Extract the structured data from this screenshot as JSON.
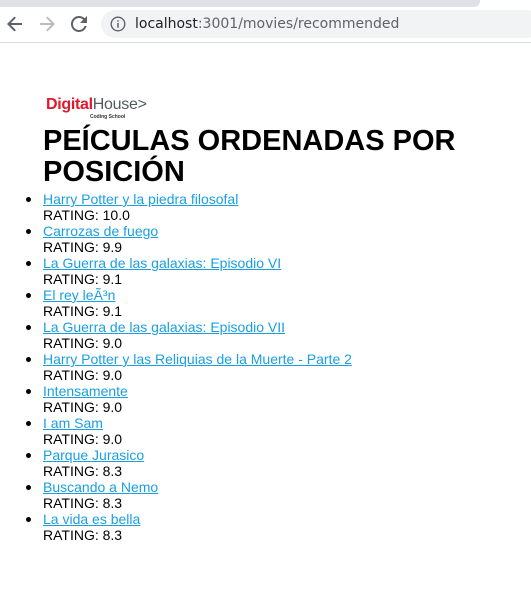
{
  "browser": {
    "url_host": "localhost",
    "url_path": ":3001/movies/recommended",
    "icons": {
      "back": "arrow-left-icon",
      "forward": "arrow-right-icon",
      "reload": "reload-icon",
      "info": "info-icon"
    }
  },
  "logo": {
    "digital": "Digital",
    "house": "House",
    "chevron": ">",
    "sub": "Coding School"
  },
  "page": {
    "title": "PEÍCULAS ORDENADAS POR POSICIÓN"
  },
  "movies": [
    {
      "title": "Harry Potter y la piedra filosofal",
      "rating": "RATING: 10.0"
    },
    {
      "title": "Carrozas de fuego",
      "rating": "RATING: 9.9"
    },
    {
      "title": "La Guerra de las galaxias: Episodio VI",
      "rating": "RATING: 9.1"
    },
    {
      "title": "El rey leÃ³n",
      "rating": "RATING: 9.1"
    },
    {
      "title": "La Guerra de las galaxias: Episodio VII",
      "rating": "RATING: 9.0"
    },
    {
      "title": "Harry Potter y las Reliquias de la Muerte - Parte 2",
      "rating": "RATING: 9.0"
    },
    {
      "title": "Intensamente",
      "rating": "RATING: 9.0"
    },
    {
      "title": "I am Sam",
      "rating": "RATING: 9.0"
    },
    {
      "title": "Parque Jurasico",
      "rating": "RATING: 8.3"
    },
    {
      "title": "Buscando a Nemo",
      "rating": "RATING: 8.3"
    },
    {
      "title": "La vida es bella",
      "rating": "RATING: 8.3"
    }
  ],
  "colors": {
    "link": "#1a9fe0",
    "logo_red": "#e0182d",
    "logo_gray": "#555a60",
    "omnibox_bg": "#f1f3f4"
  }
}
